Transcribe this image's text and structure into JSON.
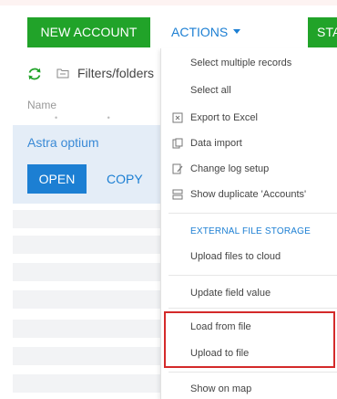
{
  "toolbar": {
    "new_account_label": "NEW ACCOUNT",
    "actions_label": "ACTIONS",
    "start_label_partial": "STA"
  },
  "list": {
    "filters_label": "Filters/folders",
    "column_name": "Name",
    "selected_record": "Astra optium",
    "open_label": "OPEN",
    "copy_label": "COPY"
  },
  "menu": {
    "items": [
      {
        "label": "Select multiple records",
        "icon": "none"
      },
      {
        "label": "Select all",
        "icon": "none"
      },
      {
        "label": "Export to Excel",
        "icon": "excel-export-icon"
      },
      {
        "label": "Data import",
        "icon": "data-import-icon"
      },
      {
        "label": "Change log setup",
        "icon": "change-log-icon"
      },
      {
        "label": "Show duplicate 'Accounts'",
        "icon": "duplicates-icon"
      }
    ],
    "section_external": "EXTERNAL FILE STORAGE",
    "upload_cloud": "Upload files to cloud",
    "update_field": "Update field value",
    "load_from_file": "Load from file",
    "upload_to_file": "Upload to file",
    "show_on_map": "Show on map"
  },
  "colors": {
    "green": "#21a329",
    "blue": "#1c7fd3",
    "highlight": "#d42a2a"
  }
}
